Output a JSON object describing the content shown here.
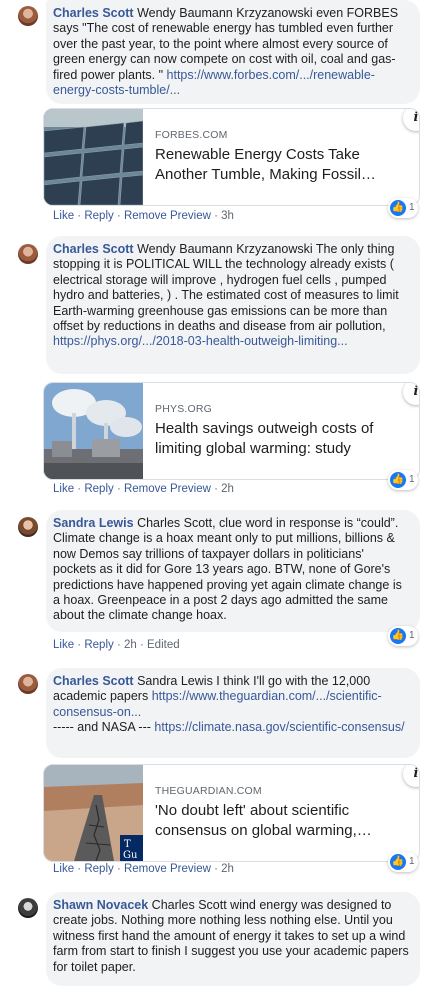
{
  "comments": [
    {
      "author": "Charles Scott",
      "text": "Wendy Baumann Krzyzanowski even FORBES says \"The cost of renewable energy has tumbled even further over the past year, to the point where almost every source of green energy can now compete on cost with oil, coal and gas-fired power plants. \"",
      "link": "https://www.forbes.com/.../renewable-energy-costs-tumble/...",
      "preview_domain": "FORBES.COM",
      "preview_title": "Renewable Energy Costs Take Another Tumble, Making Fossil…",
      "actions": [
        "Like",
        "Reply",
        "Remove Preview",
        "3h"
      ],
      "reactions": "1"
    },
    {
      "author": "Charles Scott",
      "text": "Wendy Baumann Krzyzanowski The only thing stopping it is POLITICAL WILL the technology already exists ( electrical storage will improve , hydrogen fuel cells , pumped hydro and batteries, ) . The estimated cost of measures to limit Earth-warming greenhouse gas emissions can be more than offset by reductions in deaths and disease from air pollution,",
      "link": "https://phys.org/.../2018-03-health-outweigh-limiting...",
      "preview_domain": "PHYS.ORG",
      "preview_title": "Health savings outweigh costs of limiting global warming: study",
      "actions": [
        "Like",
        "Reply",
        "Remove Preview",
        "2h"
      ],
      "reactions": "1"
    },
    {
      "author": "Sandra Lewis",
      "text": "Charles Scott, clue word in response is “could”. Climate change is a hoax meant only to put millions, billions & now Demos say trillions of taxpayer dollars in politicians' pockets as it did for Gore 13 years ago. BTW, none of Gore's predictions have happened proving yet again climate change is a hoax. Greenpeace in a post 2 days ago admitted the same about the climate change hoax.",
      "actions": [
        "Like",
        "Reply",
        "2h",
        "Edited"
      ],
      "reactions": "1"
    },
    {
      "author": "Charles Scott",
      "text": "Sandra Lewis I think I'll go with the 12,000 academic papers",
      "link": "https://www.theguardian.com/.../scientific-consensus-on...",
      "text2": "----- and NASA ---",
      "link2": "https://climate.nasa.gov/scientific-consensus/",
      "preview_domain": "THEGUARDIAN.COM",
      "preview_title": "'No doubt left' about scientific consensus on global warming,…",
      "actions": [
        "Like",
        "Reply",
        "Remove Preview",
        "2h"
      ],
      "reactions": "1"
    },
    {
      "author": "Shawn Novacek",
      "text": "Charles Scott wind energy was designed to create jobs. Nothing more nothing less nothing else. Until you witness first hand the amount of energy it takes to set up a wind farm from start to finish I suggest you use your academic papers for toilet paper."
    }
  ],
  "icons": {
    "info": "info-icon",
    "like": "like-icon"
  },
  "colors": {
    "author": "#385898",
    "bubble": "#f2f3f5",
    "like_blue": "#1877f2"
  }
}
